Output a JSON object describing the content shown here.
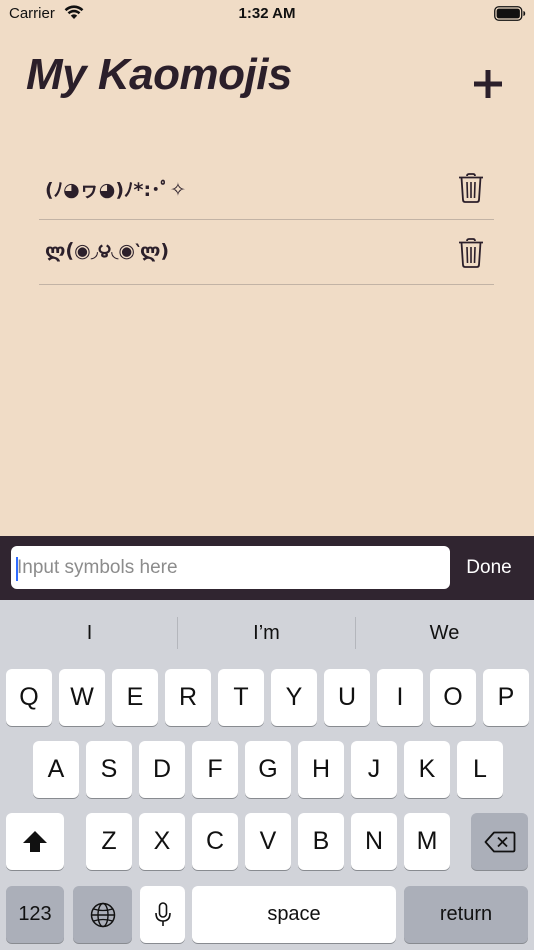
{
  "status_bar": {
    "carrier": "Carrier",
    "time": "1:32 AM"
  },
  "header": {
    "title": "My Kaomojis",
    "add_label": "+"
  },
  "kaomojis": [
    {
      "text": "(ﾉ◕ヮ◕)ﾉ*:･ﾟ✧"
    },
    {
      "text": "ლ(́◉◞౪◟◉‵ლ)"
    }
  ],
  "input_bar": {
    "placeholder": "Input symbols here",
    "value": "",
    "done_label": "Done"
  },
  "keyboard": {
    "suggestions": [
      "I",
      "I’m",
      "We"
    ],
    "row1": [
      "Q",
      "W",
      "E",
      "R",
      "T",
      "Y",
      "U",
      "I",
      "O",
      "P"
    ],
    "row2": [
      "A",
      "S",
      "D",
      "F",
      "G",
      "H",
      "J",
      "K",
      "L"
    ],
    "row3": [
      "Z",
      "X",
      "C",
      "V",
      "B",
      "N",
      "M"
    ],
    "numbers_label": "123",
    "space_label": "space",
    "return_label": "return"
  },
  "icons": {
    "add": "plus-icon",
    "delete": "trash-icon",
    "shift": "shift-icon",
    "backspace": "backspace-icon",
    "globe": "globe-icon",
    "mic": "microphone-icon"
  },
  "colors": {
    "background": "#f0dcc6",
    "input_bar": "#302530",
    "text": "#2b1f2a",
    "caret": "#2f6bff"
  }
}
